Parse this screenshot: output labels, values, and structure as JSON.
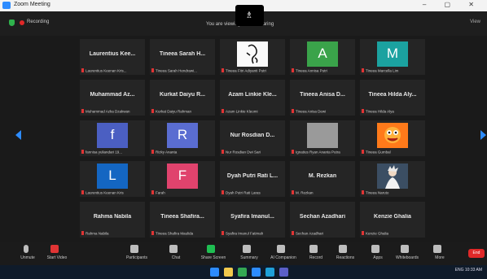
{
  "window": {
    "title": "Zoom Meeting",
    "controls": "–  ▢  ✕"
  },
  "topbar": {
    "recording_label": "Recording",
    "screen_label": "You are viewing screen sharing",
    "view_label": "View",
    "speaker_icon": "person-icon"
  },
  "participants": [
    {
      "name": "Laurentius Kee...",
      "caption": "Laurentius Keenan Kris...",
      "muted": true
    },
    {
      "name": "Tineea Sarah H...",
      "caption": "Tineea Sarah Hendrawi...",
      "muted": true
    },
    {
      "avatar": "drawing",
      "caption": "Tineea Fitri Adiyanti Putri",
      "muted": true,
      "avatar_color": "#fafafa"
    },
    {
      "avatar": "letter",
      "letter": "A",
      "caption": "Tineea Annisa Putri",
      "muted": true,
      "avatar_color": "#3aa34a"
    },
    {
      "avatar": "letter",
      "letter": "M",
      "caption": "Tineea Marcella Lim",
      "muted": true,
      "avatar_color": "#1ba2a0"
    },
    {
      "name": "Muhammad Az...",
      "caption": "Muhammad Azka Dzakwan",
      "muted": true
    },
    {
      "name": "Kurkat Daiyu R...",
      "caption": "Kurkat Daiyu Rahman",
      "muted": true
    },
    {
      "name": "Azam Linkie Kle...",
      "caption": "Azam Linkie Kleomi",
      "muted": true
    },
    {
      "name": "Tineea Anisa D...",
      "caption": "Tineea Anisa Dewi",
      "muted": true
    },
    {
      "name": "Tineea Hilda Aly...",
      "caption": "Tineea Hilda Alya",
      "muted": true
    },
    {
      "avatar": "letter",
      "letter": "f",
      "caption": "fannisa yuliandari 19...",
      "muted": true,
      "avatar_color": "#4b5fc2"
    },
    {
      "avatar": "letter",
      "letter": "R",
      "caption": "Rizky Ananta",
      "muted": true,
      "avatar_color": "#5a6dd1"
    },
    {
      "name": "Nur Rosdian D...",
      "caption": "Nur Rosdian Dwi Sari",
      "muted": true
    },
    {
      "avatar": "grey",
      "caption": "Ignatius Ryan Ananta Putra",
      "muted": true,
      "avatar_color": "#9a9a9a"
    },
    {
      "avatar": "cartoon",
      "caption": "Tineea Gumbal",
      "muted": true,
      "avatar_color": "#ff7a1a"
    },
    {
      "avatar": "letter",
      "letter": "L",
      "caption": "Laurentius Keenan Kris",
      "muted": true,
      "avatar_color": "#1466c2"
    },
    {
      "avatar": "letter",
      "letter": "F",
      "caption": "Farah",
      "muted": true,
      "avatar_color": "#e0436d"
    },
    {
      "name": "Dyah Putri Rati L...",
      "caption": "Dyah Putri Rati Laras",
      "muted": true
    },
    {
      "name": "M. Rezkan",
      "caption": "M. Rezkan",
      "muted": true
    },
    {
      "avatar": "photo",
      "caption": "Tineea Naruto",
      "muted": true,
      "avatar_color": "#3b4e63"
    },
    {
      "name": "Rahma Nabila",
      "caption": "Rahma Nabila",
      "muted": true
    },
    {
      "name": "Tineea Shafira...",
      "caption": "Tineea Shafira Maulida",
      "muted": true
    },
    {
      "name": "Syafira Imanul...",
      "caption": "Syafira Imanul Fatimah",
      "muted": true
    },
    {
      "name": "Sechan Azadhari",
      "caption": "Sechan Azadhari",
      "muted": true
    },
    {
      "name": "Kenzie Ghalia",
      "caption": "Kenzie Ghalia",
      "muted": true
    }
  ],
  "toolbar": {
    "items": [
      {
        "label": "Unmute",
        "icon": "microphone-icon"
      },
      {
        "label": "Start Video",
        "icon": "video-camera-icon"
      },
      {
        "label": "Participants",
        "icon": "participants-icon",
        "count": "25"
      },
      {
        "label": "Chat",
        "icon": "chat-icon"
      },
      {
        "label": "Share Screen",
        "icon": "share-screen-icon"
      },
      {
        "label": "Summary",
        "icon": "summary-icon"
      },
      {
        "label": "AI Companion",
        "icon": "ai-companion-icon"
      },
      {
        "label": "Record",
        "icon": "record-icon"
      },
      {
        "label": "Reactions",
        "icon": "reactions-icon"
      },
      {
        "label": "Apps",
        "icon": "apps-icon"
      },
      {
        "label": "Whiteboards",
        "icon": "whiteboard-icon"
      },
      {
        "label": "More",
        "icon": "more-icon"
      }
    ],
    "end_label": "End"
  },
  "taskbar": {
    "tray_text": "ENG  10:33 AM",
    "icons": [
      "windows-icon",
      "file-explorer-icon",
      "chrome-icon",
      "zoom-icon",
      "edge-icon",
      "teams-icon"
    ]
  }
}
